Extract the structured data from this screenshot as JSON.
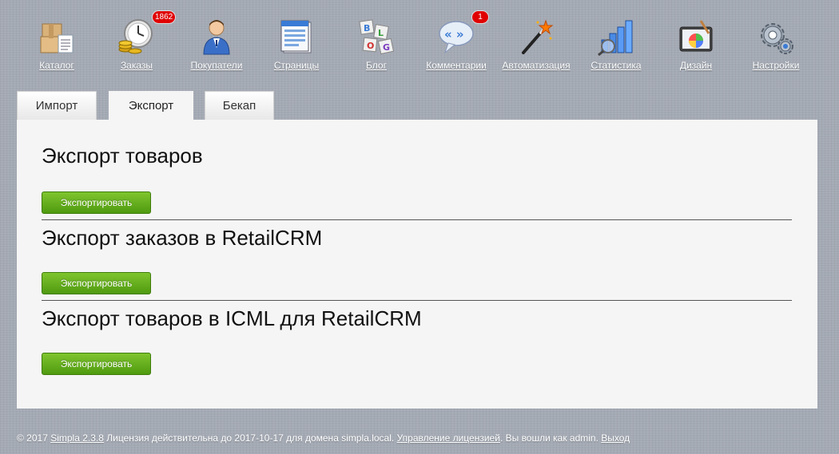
{
  "menu": {
    "items": [
      {
        "label": "Каталог",
        "icon": "catalog-boxes-icon"
      },
      {
        "label": "Заказы",
        "icon": "orders-clock-coins-icon",
        "badge": "1862"
      },
      {
        "label": "Покупатели",
        "icon": "customer-person-icon"
      },
      {
        "label": "Страницы",
        "icon": "pages-document-icon"
      },
      {
        "label": "Блог",
        "icon": "blog-cubes-icon"
      },
      {
        "label": "Комментарии",
        "icon": "comments-bubble-icon",
        "badge": "1"
      },
      {
        "label": "Автоматизация",
        "icon": "automation-wand-icon"
      },
      {
        "label": "Статистика",
        "icon": "statistics-chart-icon"
      },
      {
        "label": "Дизайн",
        "icon": "design-palette-icon"
      },
      {
        "label": "Настройки",
        "icon": "settings-gears-icon"
      }
    ]
  },
  "tabs": [
    {
      "label": "Импорт",
      "active": false
    },
    {
      "label": "Экспорт",
      "active": true
    },
    {
      "label": "Бекап",
      "active": false
    }
  ],
  "sections": [
    {
      "title": "Экспорт товаров",
      "button": "Экспортировать"
    },
    {
      "title": "Экспорт заказов в RetailCRM",
      "button": "Экспортировать"
    },
    {
      "title": "Экспорт товаров в ICML для RetailCRM",
      "button": "Экспортировать"
    }
  ],
  "footer": {
    "copyright": "© 2017",
    "product_link": "Simpla 2.3.8",
    "license_text": "Лицензия действительна до 2017-10-17 для домена simpla.local.",
    "manage_link": "Управление лицензией",
    "logged_in_text": ". Вы вошли как admin.",
    "logout_link": "Выход"
  },
  "colors": {
    "background": "#a4aab4",
    "panel": "#f5f5f5",
    "button_green": "#5aa71a",
    "badge_red": "#e00000"
  }
}
